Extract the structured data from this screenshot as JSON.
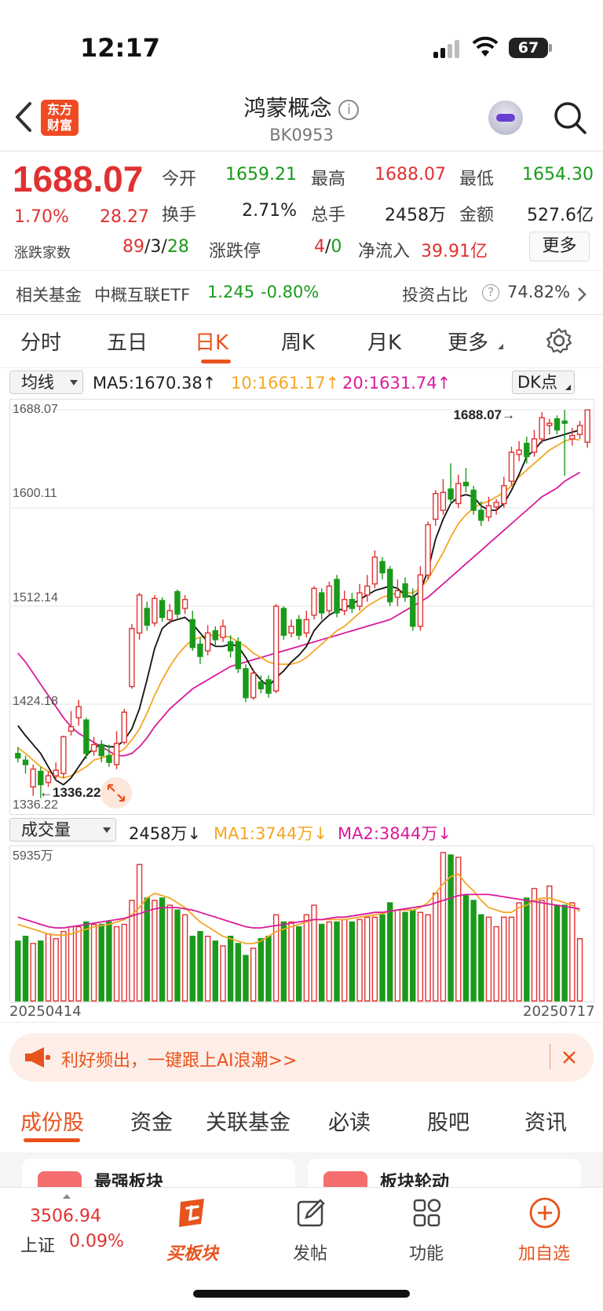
{
  "status": {
    "time": "12:17",
    "battery": "67"
  },
  "nav": {
    "logo_line1": "东方",
    "logo_line2": "财富",
    "title": "鸿蒙概念",
    "code": "BK0953"
  },
  "quote": {
    "price": "1688.07",
    "change_pct": "1.70%",
    "change": "28.27",
    "open_label": "今开",
    "open": "1659.21",
    "high_label": "最高",
    "high": "1688.07",
    "low_label": "最低",
    "low": "1654.30",
    "turnover_label": "换手",
    "turnover": "2.71%",
    "volume_label": "总手",
    "volume": "2458万",
    "amount_label": "金额",
    "amount": "527.6亿",
    "updown_label": "涨跌家数",
    "up": "89",
    "flat": "3",
    "down": "28",
    "limit_label": "涨跌停",
    "limit_up": "4",
    "limit_down": "0",
    "inflow_label": "净流入",
    "inflow": "39.91亿",
    "more_label": "更多",
    "slash": "/"
  },
  "fund": {
    "label": "相关基金",
    "name": "中概互联ETF",
    "price": "1.245",
    "pct": "-0.80%",
    "ratio_label": "投资占比",
    "ratio": "74.82%"
  },
  "tabs": [
    "分时",
    "五日",
    "日K",
    "周K",
    "月K",
    "更多"
  ],
  "ma_row": {
    "selector": "均线",
    "ma5": "MA5:1670.38",
    "ma10": "10:1661.17",
    "ma20": "20:1631.74",
    "up_arrow": "↑",
    "dk": "DK点"
  },
  "kchart_labels": {
    "y1": "1688.07",
    "y2": "1600.11",
    "y3": "1512.14",
    "y4": "1424.18",
    "y5": "1336.22",
    "high_marker": "1688.07",
    "low_marker": "1336.22",
    "marker_arrow_right": "→",
    "marker_arrow_left": "←"
  },
  "vol_row": {
    "selector": "成交量",
    "vol": "2458万",
    "ma1": "MA1:3744万",
    "ma2": "MA2:3844万",
    "down_arrow": "↓",
    "max": "5935万"
  },
  "dates": {
    "start": "20250414",
    "end": "20250717"
  },
  "banner": {
    "text": "利好频出，一键跟上AI浪潮>>"
  },
  "subtabs": [
    "成份股",
    "资金",
    "关联基金",
    "必读",
    "股吧",
    "资讯"
  ],
  "cards": [
    "最强板块",
    "板块轮动"
  ],
  "bottom": {
    "index_value": "3506.94",
    "index_name": "上证",
    "index_pct": "0.09%",
    "buy": "买板块",
    "post": "发帖",
    "func": "功能",
    "add": "加自选"
  },
  "colors": {
    "up": "#e03131",
    "down": "#1a9a1a",
    "accent": "#e8531d",
    "ma10": "#f5a623",
    "ma20": "#d81b9a"
  },
  "chart_data": {
    "type": "candlestick",
    "ylim": [
      1336.22,
      1688.07
    ],
    "candles": [
      {
        "o": 1380,
        "c": 1376,
        "h": 1386,
        "l": 1372
      },
      {
        "o": 1374,
        "c": 1370,
        "h": 1378,
        "l": 1362
      },
      {
        "o": 1350,
        "c": 1366,
        "h": 1370,
        "l": 1342
      },
      {
        "o": 1364,
        "c": 1352,
        "h": 1368,
        "l": 1340
      },
      {
        "o": 1354,
        "c": 1360,
        "h": 1364,
        "l": 1350
      },
      {
        "o": 1360,
        "c": 1365,
        "h": 1372,
        "l": 1356
      },
      {
        "o": 1362,
        "c": 1395,
        "h": 1396,
        "l": 1358
      },
      {
        "o": 1400,
        "c": 1404,
        "h": 1418,
        "l": 1396
      },
      {
        "o": 1412,
        "c": 1422,
        "h": 1428,
        "l": 1405
      },
      {
        "o": 1410,
        "c": 1380,
        "h": 1412,
        "l": 1375
      },
      {
        "o": 1382,
        "c": 1388,
        "h": 1395,
        "l": 1378
      },
      {
        "o": 1388,
        "c": 1378,
        "h": 1392,
        "l": 1372
      },
      {
        "o": 1378,
        "c": 1372,
        "h": 1388,
        "l": 1368
      },
      {
        "o": 1370,
        "c": 1389,
        "h": 1400,
        "l": 1366
      },
      {
        "o": 1390,
        "c": 1417,
        "h": 1420,
        "l": 1388
      },
      {
        "o": 1440,
        "c": 1492,
        "h": 1496,
        "l": 1438
      },
      {
        "o": 1488,
        "c": 1522,
        "h": 1524,
        "l": 1482
      },
      {
        "o": 1510,
        "c": 1495,
        "h": 1516,
        "l": 1490
      },
      {
        "o": 1497,
        "c": 1519,
        "h": 1522,
        "l": 1494
      },
      {
        "o": 1517,
        "c": 1502,
        "h": 1520,
        "l": 1498
      },
      {
        "o": 1500,
        "c": 1508,
        "h": 1514,
        "l": 1496
      },
      {
        "o": 1525,
        "c": 1505,
        "h": 1527,
        "l": 1500
      },
      {
        "o": 1510,
        "c": 1518,
        "h": 1522,
        "l": 1505
      },
      {
        "o": 1500,
        "c": 1475,
        "h": 1508,
        "l": 1472
      },
      {
        "o": 1478,
        "c": 1467,
        "h": 1484,
        "l": 1460
      },
      {
        "o": 1472,
        "c": 1488,
        "h": 1495,
        "l": 1468
      },
      {
        "o": 1490,
        "c": 1482,
        "h": 1494,
        "l": 1476
      },
      {
        "o": 1484,
        "c": 1494,
        "h": 1500,
        "l": 1480
      },
      {
        "o": 1480,
        "c": 1472,
        "h": 1486,
        "l": 1466
      },
      {
        "o": 1480,
        "c": 1456,
        "h": 1484,
        "l": 1452
      },
      {
        "o": 1456,
        "c": 1430,
        "h": 1460,
        "l": 1426
      },
      {
        "o": 1430,
        "c": 1452,
        "h": 1456,
        "l": 1428
      },
      {
        "o": 1444,
        "c": 1438,
        "h": 1450,
        "l": 1434
      },
      {
        "o": 1446,
        "c": 1434,
        "h": 1450,
        "l": 1430
      },
      {
        "o": 1436,
        "c": 1512,
        "h": 1514,
        "l": 1434
      },
      {
        "o": 1510,
        "c": 1486,
        "h": 1512,
        "l": 1482
      },
      {
        "o": 1488,
        "c": 1494,
        "h": 1500,
        "l": 1484
      },
      {
        "o": 1500,
        "c": 1486,
        "h": 1504,
        "l": 1482
      },
      {
        "o": 1488,
        "c": 1500,
        "h": 1508,
        "l": 1484
      },
      {
        "o": 1504,
        "c": 1528,
        "h": 1530,
        "l": 1500
      },
      {
        "o": 1524,
        "c": 1506,
        "h": 1528,
        "l": 1500
      },
      {
        "o": 1508,
        "c": 1530,
        "h": 1534,
        "l": 1504
      },
      {
        "o": 1536,
        "c": 1506,
        "h": 1540,
        "l": 1502
      },
      {
        "o": 1508,
        "c": 1518,
        "h": 1526,
        "l": 1504
      },
      {
        "o": 1518,
        "c": 1510,
        "h": 1524,
        "l": 1506
      },
      {
        "o": 1512,
        "c": 1524,
        "h": 1532,
        "l": 1508
      },
      {
        "o": 1522,
        "c": 1530,
        "h": 1540,
        "l": 1516
      },
      {
        "o": 1532,
        "c": 1556,
        "h": 1562,
        "l": 1528
      },
      {
        "o": 1552,
        "c": 1542,
        "h": 1556,
        "l": 1536
      },
      {
        "o": 1545,
        "c": 1516,
        "h": 1548,
        "l": 1512
      },
      {
        "o": 1520,
        "c": 1526,
        "h": 1536,
        "l": 1512
      },
      {
        "o": 1532,
        "c": 1520,
        "h": 1538,
        "l": 1516
      },
      {
        "o": 1520,
        "c": 1494,
        "h": 1528,
        "l": 1490
      },
      {
        "o": 1494,
        "c": 1540,
        "h": 1548,
        "l": 1490
      },
      {
        "o": 1540,
        "c": 1585,
        "h": 1588,
        "l": 1536
      },
      {
        "o": 1590,
        "c": 1613,
        "h": 1616,
        "l": 1584
      },
      {
        "o": 1598,
        "c": 1614,
        "h": 1626,
        "l": 1594
      },
      {
        "o": 1617,
        "c": 1608,
        "h": 1640,
        "l": 1604
      },
      {
        "o": 1604,
        "c": 1622,
        "h": 1630,
        "l": 1600
      },
      {
        "o": 1623,
        "c": 1620,
        "h": 1636,
        "l": 1614
      },
      {
        "o": 1616,
        "c": 1598,
        "h": 1620,
        "l": 1594
      },
      {
        "o": 1598,
        "c": 1589,
        "h": 1606,
        "l": 1584
      },
      {
        "o": 1592,
        "c": 1602,
        "h": 1610,
        "l": 1588
      },
      {
        "o": 1601,
        "c": 1605,
        "h": 1608,
        "l": 1594
      },
      {
        "o": 1604,
        "c": 1620,
        "h": 1628,
        "l": 1600
      },
      {
        "o": 1624,
        "c": 1650,
        "h": 1655,
        "l": 1620
      },
      {
        "o": 1648,
        "c": 1652,
        "h": 1660,
        "l": 1642
      },
      {
        "o": 1658,
        "c": 1646,
        "h": 1664,
        "l": 1640
      },
      {
        "o": 1650,
        "c": 1662,
        "h": 1670,
        "l": 1646
      },
      {
        "o": 1662,
        "c": 1681,
        "h": 1686,
        "l": 1658
      },
      {
        "o": 1674,
        "c": 1676,
        "h": 1680,
        "l": 1666
      },
      {
        "o": 1680,
        "c": 1670,
        "h": 1683,
        "l": 1666
      },
      {
        "o": 1678,
        "c": 1676,
        "h": 1688,
        "l": 1629
      },
      {
        "o": 1662,
        "c": 1665,
        "h": 1672,
        "l": 1656
      },
      {
        "o": 1666,
        "c": 1674,
        "h": 1678,
        "l": 1662
      },
      {
        "o": 1659,
        "c": 1688,
        "h": 1688,
        "l": 1654
      }
    ],
    "ma5": [
      1405,
      1396,
      1388,
      1380,
      1368,
      1356,
      1352,
      1358,
      1368,
      1378,
      1385,
      1388,
      1386,
      1386,
      1392,
      1402,
      1420,
      1446,
      1474,
      1492,
      1498,
      1500,
      1502,
      1496,
      1488,
      1480,
      1476,
      1476,
      1478,
      1476,
      1466,
      1454,
      1446,
      1440,
      1448,
      1454,
      1462,
      1468,
      1476,
      1490,
      1498,
      1504,
      1508,
      1510,
      1514,
      1518,
      1522,
      1526,
      1528,
      1530,
      1528,
      1522,
      1520,
      1526,
      1544,
      1572,
      1590,
      1604,
      1610,
      1612,
      1610,
      1602,
      1598,
      1598,
      1604,
      1616,
      1630,
      1646,
      1652,
      1660,
      1662,
      1664,
      1666,
      1668,
      1670
    ],
    "ma10": [
      1385,
      1380,
      1374,
      1368,
      1364,
      1360,
      1358,
      1360,
      1364,
      1368,
      1374,
      1376,
      1378,
      1380,
      1384,
      1392,
      1402,
      1416,
      1432,
      1446,
      1458,
      1468,
      1476,
      1482,
      1484,
      1486,
      1486,
      1486,
      1484,
      1480,
      1476,
      1470,
      1466,
      1462,
      1460,
      1460,
      1460,
      1462,
      1466,
      1472,
      1478,
      1484,
      1490,
      1494,
      1500,
      1506,
      1512,
      1516,
      1520,
      1522,
      1524,
      1524,
      1524,
      1528,
      1536,
      1548,
      1560,
      1574,
      1586,
      1594,
      1600,
      1604,
      1606,
      1610,
      1614,
      1620,
      1628,
      1634,
      1640,
      1646,
      1652,
      1656,
      1660,
      1662,
      1661
    ],
    "ma20": [
      1470,
      1462,
      1452,
      1442,
      1432,
      1422,
      1412,
      1404,
      1398,
      1394,
      1390,
      1386,
      1382,
      1378,
      1378,
      1380,
      1386,
      1394,
      1404,
      1412,
      1420,
      1426,
      1432,
      1438,
      1442,
      1446,
      1450,
      1454,
      1458,
      1460,
      1462,
      1464,
      1466,
      1468,
      1470,
      1472,
      1474,
      1476,
      1478,
      1480,
      1482,
      1484,
      1486,
      1488,
      1490,
      1492,
      1494,
      1496,
      1498,
      1500,
      1504,
      1508,
      1512,
      1516,
      1520,
      1526,
      1532,
      1538,
      1544,
      1550,
      1556,
      1562,
      1568,
      1574,
      1580,
      1586,
      1592,
      1598,
      1604,
      1610,
      1614,
      1618,
      1624,
      1628,
      1632
    ],
    "volume": {
      "max": 5935,
      "bars": [
        2500,
        2700,
        2400,
        2500,
        2800,
        2600,
        2900,
        3100,
        3100,
        3300,
        3200,
        3200,
        3300,
        3100,
        3200,
        4200,
        5700,
        4300,
        4200,
        4300,
        4000,
        3800,
        3600,
        2700,
        2900,
        2700,
        2500,
        2300,
        2700,
        2400,
        1900,
        2200,
        2600,
        2700,
        3600,
        3300,
        3300,
        3100,
        3600,
        4000,
        3200,
        3300,
        3300,
        3400,
        3300,
        3400,
        3500,
        3500,
        3600,
        4100,
        3800,
        3700,
        3800,
        3700,
        3600,
        4500,
        6200,
        6100,
        6000,
        4400,
        4200,
        3600,
        3500,
        3100,
        3500,
        3500,
        4100,
        4300,
        4700,
        4200,
        4800,
        4000,
        4000,
        4100,
        2600
      ],
      "ma1": [
        3200,
        3100,
        3000,
        2900,
        2800,
        2750,
        2750,
        2800,
        2900,
        3000,
        3100,
        3150,
        3200,
        3300,
        3400,
        3600,
        3900,
        4300,
        4500,
        4400,
        4300,
        4100,
        3900,
        3600,
        3300,
        3100,
        2900,
        2700,
        2600,
        2500,
        2400,
        2400,
        2500,
        2700,
        2900,
        3000,
        3100,
        3200,
        3300,
        3400,
        3400,
        3400,
        3400,
        3400,
        3450,
        3500,
        3550,
        3600,
        3650,
        3750,
        3800,
        3800,
        3800,
        3900,
        4100,
        4500,
        4900,
        5200,
        5300,
        4900,
        4600,
        4200,
        3900,
        3800,
        3700,
        3700,
        3900,
        4000,
        4200,
        4300,
        4300,
        4200,
        4100,
        4000,
        3744
      ],
      "ma2": [
        3500,
        3400,
        3300,
        3200,
        3100,
        3050,
        3050,
        3100,
        3150,
        3200,
        3250,
        3300,
        3350,
        3400,
        3450,
        3550,
        3650,
        3750,
        3850,
        3900,
        3900,
        3900,
        3850,
        3800,
        3700,
        3600,
        3500,
        3400,
        3300,
        3200,
        3100,
        3050,
        3050,
        3100,
        3150,
        3200,
        3250,
        3300,
        3350,
        3400,
        3400,
        3450,
        3500,
        3500,
        3550,
        3600,
        3650,
        3700,
        3700,
        3750,
        3800,
        3850,
        3900,
        3950,
        4000,
        4100,
        4200,
        4300,
        4400,
        4450,
        4450,
        4450,
        4450,
        4400,
        4350,
        4300,
        4250,
        4200,
        4150,
        4100,
        4050,
        4000,
        3950,
        3900,
        3844
      ]
    }
  }
}
